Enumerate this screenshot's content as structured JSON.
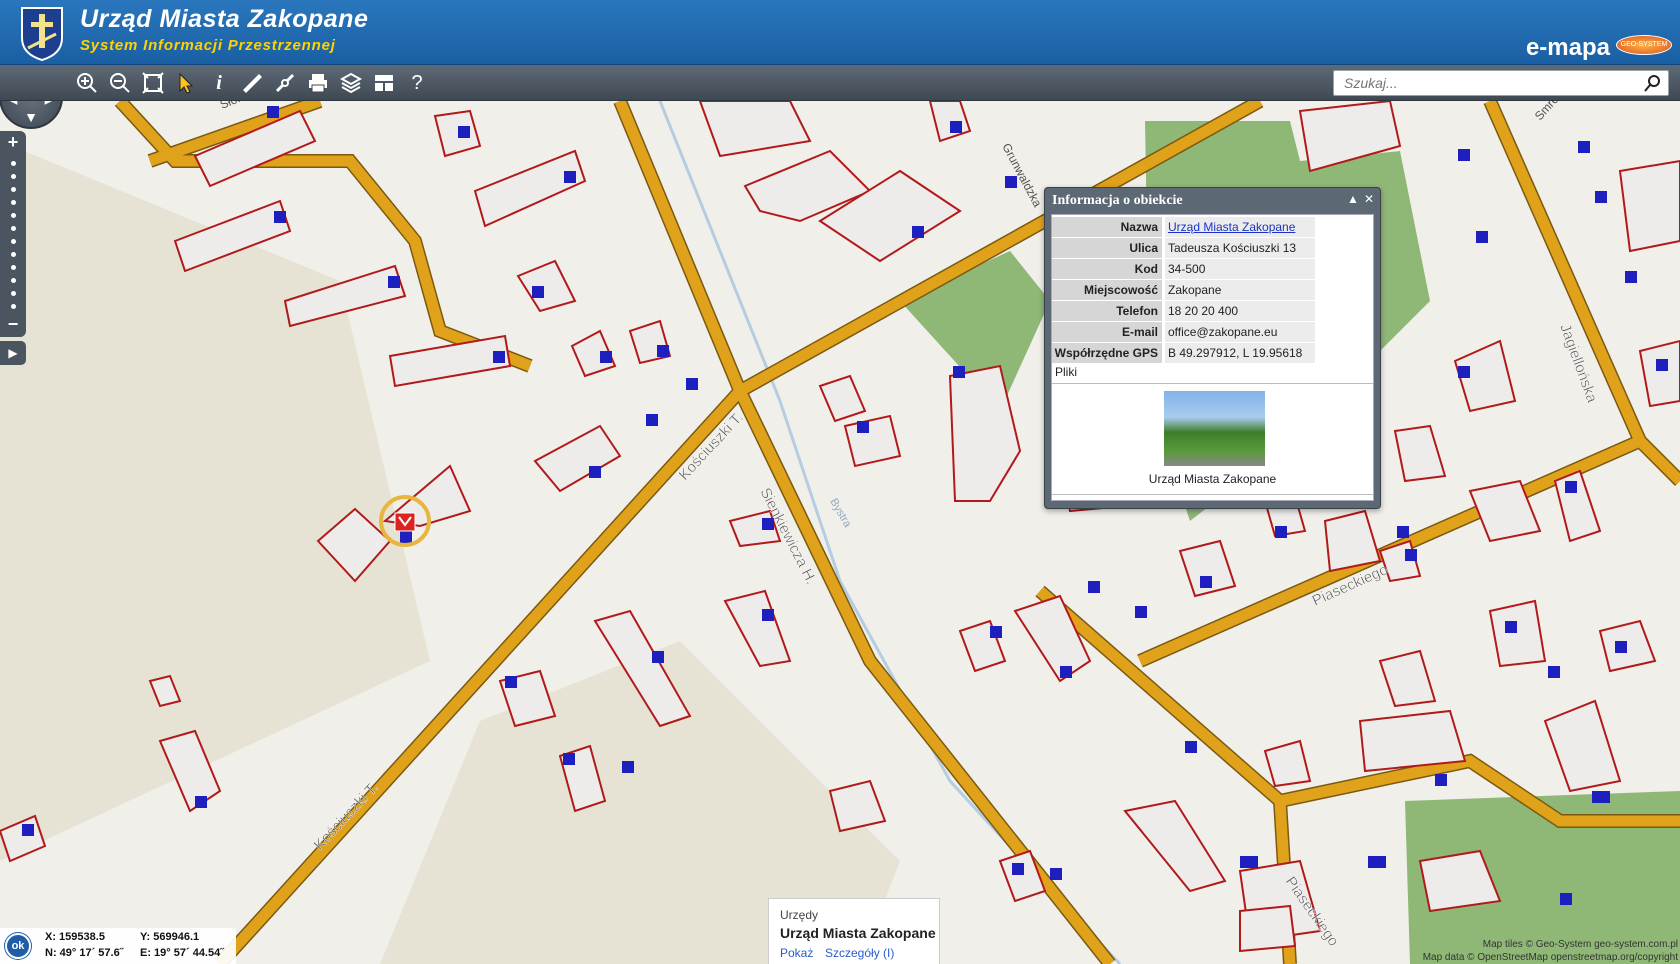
{
  "header": {
    "title": "Urząd Miasta Zakopane",
    "subtitle": "System Informacji Przestrzennej",
    "brand": "e-mapa",
    "brand_badge": "GEO-SYSTEM"
  },
  "toolbar": {
    "tools": [
      "zoom-in-icon",
      "zoom-out-icon",
      "zoom-extent-icon",
      "select-arrow-icon",
      "info-icon",
      "measure-distance-icon",
      "measure-area-icon",
      "print-icon",
      "layers-icon",
      "layout-icon",
      "help-icon"
    ],
    "search_placeholder": "Szukaj..."
  },
  "map": {
    "street_labels": [
      "Kościuszki T.",
      "Kościuszki T.",
      "Sienkiewicza H.",
      "Piaseckiego",
      "Piaseckiego",
      "Jagiellońska",
      "Bystra",
      "Słoneczna",
      "Grunwaldzka",
      "Smrekowa"
    ],
    "colors": {
      "road": "#e0a21b",
      "building_fill": "#edeceb",
      "building_border": "#b11a1a",
      "green": "#8fb877",
      "label": "#1d1fbf"
    }
  },
  "popup": {
    "title": "Informacja o obiekcie",
    "rows": [
      {
        "key": "Nazwa",
        "value": "Urząd Miasta Zakopane",
        "link": true
      },
      {
        "key": "Ulica",
        "value": "Tadeusza Kościuszki 13"
      },
      {
        "key": "Kod",
        "value": "34-500"
      },
      {
        "key": "Miejscowość",
        "value": "Zakopane"
      },
      {
        "key": "Telefon",
        "value": "18 20 20 400"
      },
      {
        "key": "E-mail",
        "value": "office@zakopane.eu"
      },
      {
        "key": "Współrzędne GPS",
        "value": "B 49.297912, L 19.95618"
      }
    ],
    "files_label": "Pliki",
    "photo_caption": "Urząd Miasta Zakopane"
  },
  "place_card": {
    "category": "Urzędy",
    "name": "Urząd Miasta Zakopane",
    "show_label": "Pokaż",
    "details_label": "Szczegóły (I)"
  },
  "coords": {
    "ok_label": "ok",
    "x": "X: 159538.5",
    "y": "Y: 569946.1",
    "n": "N: 49° 17´ 57.6˝",
    "e": "E: 19° 57´ 44.54˝"
  },
  "attribution": {
    "line1": "Map tiles © Geo-System geo-system.com.pl",
    "line2": "Map data © OpenStreetMap openstreetmap.org/copyright"
  }
}
